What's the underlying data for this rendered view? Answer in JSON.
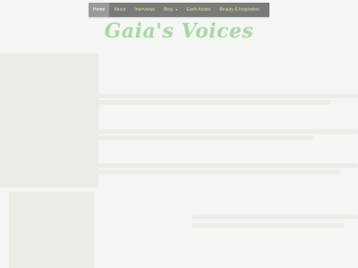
{
  "nav": {
    "items": [
      {
        "label": "Home",
        "active": true
      },
      {
        "label": "About",
        "active": false
      },
      {
        "label": "Interviews",
        "active": false
      },
      {
        "label": "Blog",
        "active": false,
        "has_dropdown": true
      },
      {
        "label": "Earth Action",
        "active": false
      },
      {
        "label": "Beauty & Inspiration",
        "active": false
      }
    ]
  },
  "site": {
    "title": "Gaia's Voices"
  },
  "colors": {
    "nav_bg": "#7a7a7a",
    "nav_text": "#e4dc8a",
    "title": "#a8d8a4",
    "page_bg": "#f3f6f2"
  }
}
